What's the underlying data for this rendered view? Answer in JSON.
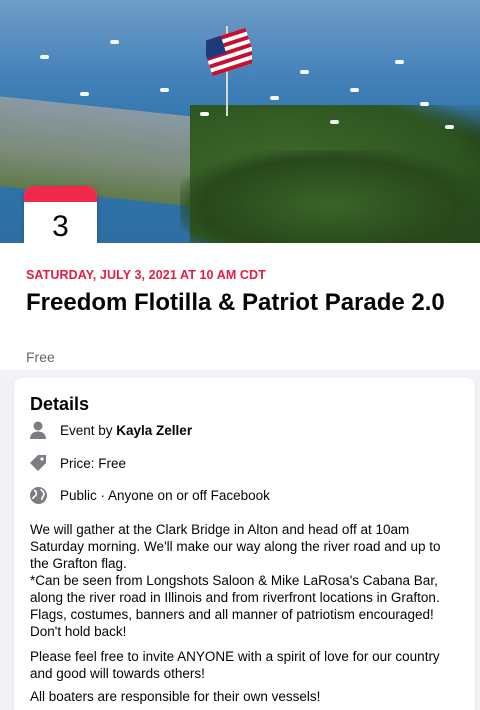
{
  "event": {
    "date_day": "3",
    "date_full": "SATURDAY, JULY 3, 2021 AT 10 AM CDT",
    "title": "Freedom Flotilla & Patriot Parade 2.0",
    "price": "Free"
  },
  "details": {
    "heading": "Details",
    "host_prefix": "Event by ",
    "host_name": "Kayla Zeller",
    "price_line": "Price: Free",
    "privacy": "Public · Anyone on or off Facebook",
    "paragraph1": "We will gather at the Clark Bridge in Alton and head off at 10am Saturday morning. We'll make our way along the river road and up to the Grafton flag.",
    "paragraph2": "*Can be seen from Longshots Saloon & Mike LaRosa's Cabana Bar, along the river road in Illinois and from riverfront locations in Grafton. Flags, costumes, banners and all manner of patriotism encouraged! Don't hold back!",
    "paragraph3": "Please feel free to invite ANYONE with a spirit of love for our country and good will towards others!",
    "paragraph4": "All boaters are responsible for their own vessels!"
  },
  "icons": {
    "host": "person-icon",
    "price": "tag-icon",
    "privacy": "globe-icon"
  },
  "colors": {
    "date_accent": "#e41e3f",
    "badge_band": "#f02849",
    "muted_text": "#65676b"
  }
}
